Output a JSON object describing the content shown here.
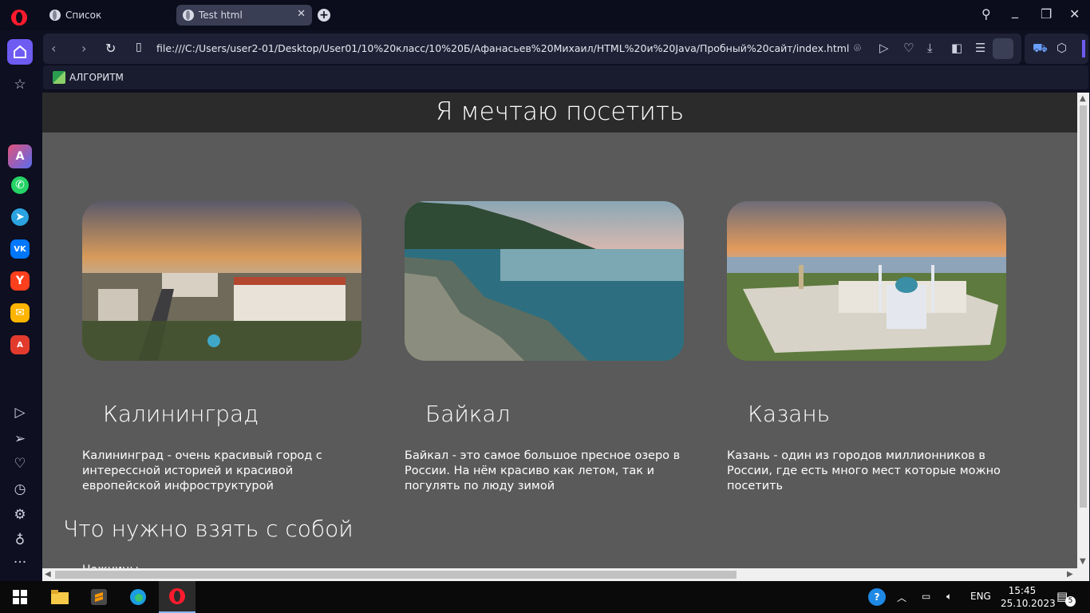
{
  "browser": {
    "tabs": [
      {
        "label": "Список",
        "active": false
      },
      {
        "label": "Test html",
        "active": true
      }
    ],
    "url": "file:///C:/Users/user2-01/Desktop/User01/10%20класс/10%20Б/Афанасьев%20Михаил/HTML%20и%20Java/Пробный%20сайт/index.html",
    "bookmark": "АЛГОРИТМ"
  },
  "page": {
    "title": "Я мечтаю посетить",
    "cards": [
      {
        "title": "Калининград",
        "text": "Калининград - очень красивый город с интерессной историей и красивой европейской инфроструктурой",
        "image": "kaliningrad-photo"
      },
      {
        "title": "Байкал",
        "text": "Байкал - это самое большое пресное озеро в России. На нём красиво как летом, так и погулять по люду зимой",
        "image": "baikal-photo"
      },
      {
        "title": "Казань",
        "text": "Казань - один из городов миллионников в России, где есть много мест которые можно посетить",
        "image": "kazan-photo"
      }
    ],
    "section_title": "Что нужно взять с собой",
    "cutoff_text": "Ножницы"
  },
  "taskbar": {
    "language": "ENG",
    "time": "15:45",
    "date": "25.10.2023",
    "notifications": "5"
  },
  "colors": {
    "page_bg": "#5a5a5a",
    "header_bg": "#2b2b2b",
    "accent": "#6d5bf2"
  }
}
